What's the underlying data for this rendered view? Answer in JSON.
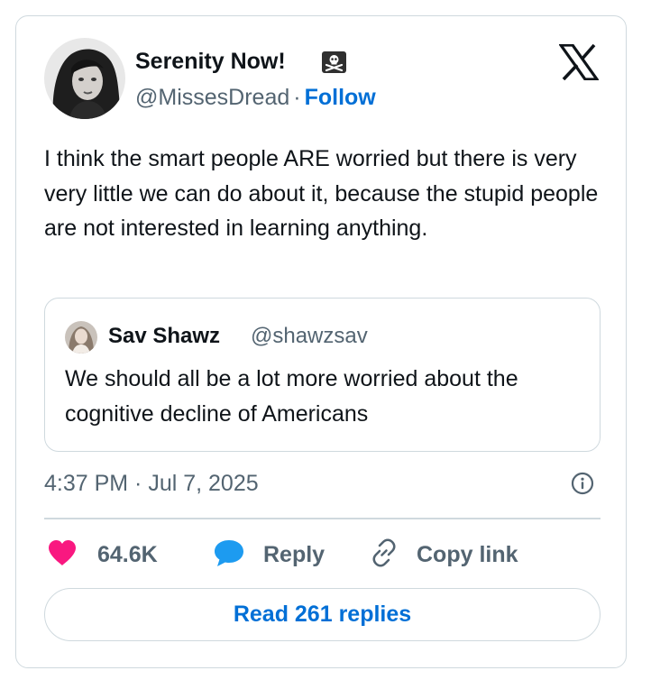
{
  "author": {
    "display_name": "Serenity Now!",
    "badge_icon": "skull-crossbones-icon",
    "handle": "@MissesDread",
    "separator": "·",
    "follow_label": "Follow"
  },
  "logo_icon": "x-logo-icon",
  "tweet": {
    "text": "I think the smart people ARE worried but there is very very little we can do about it, because the stupid people are not interested in learning anything."
  },
  "quoted_tweet": {
    "display_name": "Sav Shawz",
    "handle": "@shawzsav",
    "text": "We should all be a lot more worried about the cognitive decline of Americans"
  },
  "timestamp": "4:37 PM · Jul 7, 2025",
  "actions": {
    "likes": "64.6K",
    "reply_label": "Reply",
    "copy_link_label": "Copy link"
  },
  "read_replies_label": "Read 261 replies",
  "colors": {
    "accent_blue": "#006fd6",
    "like_pink": "#f91880",
    "reply_blue": "#1d9bf0",
    "secondary_text": "#536471",
    "border": "#cfd9de"
  }
}
